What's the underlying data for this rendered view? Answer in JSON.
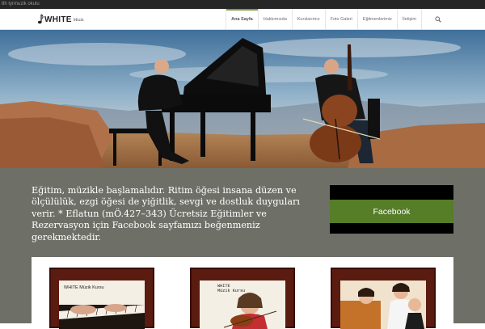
{
  "topbar": {
    "text": "8h tyrmuzik okulu"
  },
  "header": {
    "logo_text": "WHITE",
    "logo_sub": "Müzik",
    "nav": [
      {
        "label": "Ana Sayfa",
        "active": true
      },
      {
        "label": "Hakkımızda"
      },
      {
        "label": "Kurslarımız"
      },
      {
        "label": "Foto Galeri"
      },
      {
        "label": "Eğitmenlerimiz"
      },
      {
        "label": "İletişim"
      }
    ],
    "search_icon": "search-icon"
  },
  "intro": {
    "text": "Eğitim, müzikle başlamalıdır. Ritim öğesi insana düzen ve ölçülülük, ezgi öğesi de yiğitlik, sevgi ve dostluk duyguları verir. * Eflatun (mÖ.427–343) Ücretsiz Eğitimler ve Rezervasyon için Facebook sayfamızı beğenmeniz gerekmektedir.",
    "facebook_label": "Facebook"
  },
  "gallery": {
    "cards": [
      {
        "title": "WHITE Müzik Kursu"
      },
      {
        "title_line1": "WHITE",
        "title_line2": "Müzik Kursu"
      },
      {
        "title": ""
      }
    ]
  },
  "colors": {
    "topbar": "#262626",
    "accent_green": "#567d27",
    "intro_bg": "#6e7068",
    "frame": "#5a1b10"
  }
}
